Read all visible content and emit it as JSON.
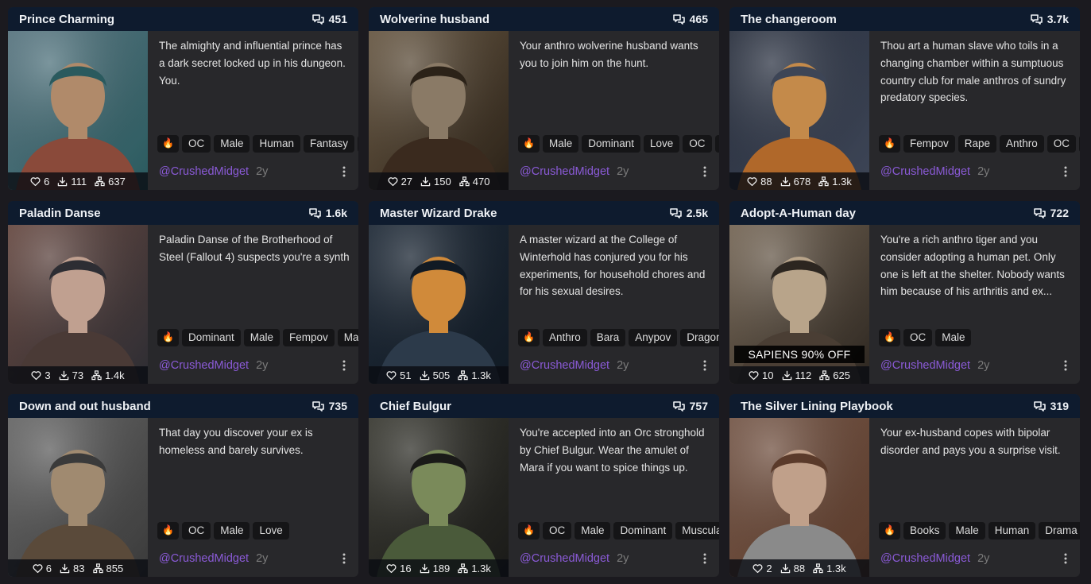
{
  "cards": [
    {
      "title": "Prince Charming",
      "count": "451",
      "description": "The almighty and influential prince has a dark secret locked up in his dungeon. You.",
      "tags": [
        "OC",
        "Male",
        "Human",
        "Fantasy",
        ""
      ],
      "likes": "6",
      "downloads": "111",
      "forks": "637",
      "author": "@CrushedMidget",
      "age": "2y",
      "sale": ""
    },
    {
      "title": "Wolverine husband",
      "count": "465",
      "description": "Your anthro wolverine husband wants you to join him on the hunt.",
      "tags": [
        "Male",
        "Dominant",
        "Love",
        "OC",
        ""
      ],
      "likes": "27",
      "downloads": "150",
      "forks": "470",
      "author": "@CrushedMidget",
      "age": "2y",
      "sale": ""
    },
    {
      "title": "The changeroom",
      "count": "3.7k",
      "description": "Thou art a human slave who toils in a changing chamber within a sumptuous country club for male anthros of sundry predatory species.",
      "tags": [
        "Fempov",
        "Rape",
        "Anthro",
        "OC",
        ""
      ],
      "likes": "88",
      "downloads": "678",
      "forks": "1.3k",
      "author": "@CrushedMidget",
      "age": "2y",
      "sale": ""
    },
    {
      "title": "Paladin Danse",
      "count": "1.6k",
      "description": "Paladin Danse of the Brotherhood of Steel (Fallout 4) suspects you're a synth",
      "tags": [
        "Dominant",
        "Male",
        "Fempov",
        "Male"
      ],
      "likes": "3",
      "downloads": "73",
      "forks": "1.4k",
      "author": "@CrushedMidget",
      "age": "2y",
      "sale": ""
    },
    {
      "title": "Master Wizard Drake",
      "count": "2.5k",
      "description": "A master wizard at the College of Winterhold has conjured you for his experiments, for household chores and for his sexual desires.",
      "tags": [
        "Anthro",
        "Bara",
        "Anypov",
        "Dragon"
      ],
      "likes": "51",
      "downloads": "505",
      "forks": "1.3k",
      "author": "@CrushedMidget",
      "age": "2y",
      "sale": ""
    },
    {
      "title": "Adopt-A-Human day",
      "count": "722",
      "description": "You're a rich anthro tiger and you consider adopting a human pet. Only one is left at the shelter. Nobody wants him because of his arthritis and ex...",
      "tags": [
        "OC",
        "Male"
      ],
      "likes": "10",
      "downloads": "112",
      "forks": "625",
      "author": "@CrushedMidget",
      "age": "2y",
      "sale": "SAPIENS 90% OFF"
    },
    {
      "title": "Down and out husband",
      "count": "735",
      "description": "That day you discover your ex is homeless and barely survives.",
      "tags": [
        "OC",
        "Male",
        "Love"
      ],
      "likes": "6",
      "downloads": "83",
      "forks": "855",
      "author": "@CrushedMidget",
      "age": "2y",
      "sale": ""
    },
    {
      "title": "Chief Bulgur",
      "count": "757",
      "description": "You're accepted into an Orc stronghold by Chief Bulgur. Wear the amulet of Mara if you want to spice things up.",
      "tags": [
        "OC",
        "Male",
        "Dominant",
        "Muscula"
      ],
      "likes": "16",
      "downloads": "189",
      "forks": "1.3k",
      "author": "@CrushedMidget",
      "age": "2y",
      "sale": ""
    },
    {
      "title": "The Silver Lining Playbook",
      "count": "319",
      "description": "Your ex-husband copes with bipolar disorder and pays you a surprise visit.",
      "tags": [
        "Books",
        "Male",
        "Human",
        "Drama"
      ],
      "likes": "2",
      "downloads": "88",
      "forks": "1.3k",
      "author": "@CrushedMidget",
      "age": "2y",
      "sale": ""
    }
  ],
  "fire_tag": "🔥",
  "icons": {
    "count": "chat-bubbles-icon",
    "like": "heart-icon",
    "download": "download-icon",
    "fork": "fork-icon",
    "more": "more-vertical-icon"
  },
  "colors": {
    "author": "#8a5ad6",
    "header": "#0e1b2e",
    "card": "#28282b",
    "background": "#1b1a1f"
  }
}
